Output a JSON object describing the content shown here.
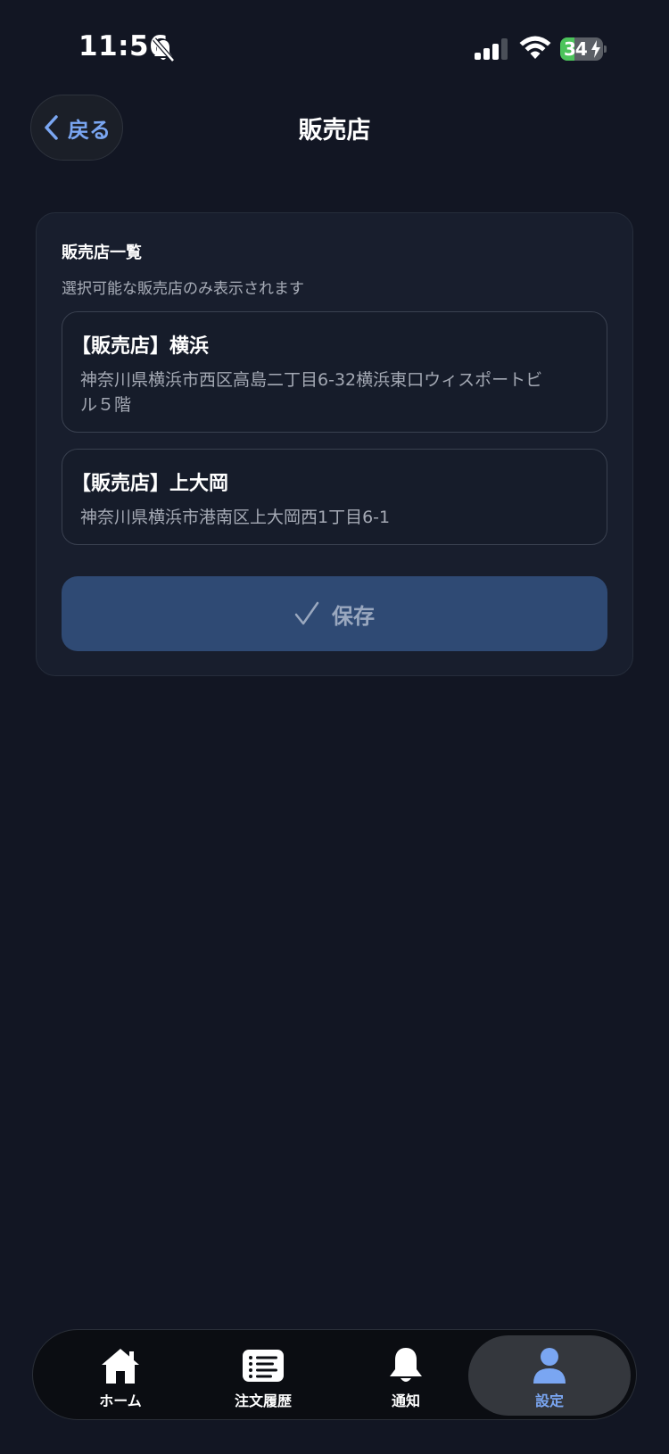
{
  "status_bar": {
    "time": "11:56",
    "battery_level": "34",
    "battery_fraction": 0.34
  },
  "header": {
    "back_label": "戻る",
    "title": "販売店"
  },
  "card": {
    "title": "販売店一覧",
    "subtitle": "選択可能な販売店のみ表示されます",
    "stores": [
      {
        "name": "【販売店】横浜",
        "address": "神奈川県横浜市西区高島二丁目6-32横浜東口ウィスポートビル５階"
      },
      {
        "name": "【販売店】上大岡",
        "address": "神奈川県横浜市港南区上大岡西1丁目6-1"
      }
    ],
    "save_label": "保存"
  },
  "tab_bar": {
    "items": [
      {
        "label": "ホーム",
        "icon": "home-icon"
      },
      {
        "label": "注文履歴",
        "icon": "list-icon"
      },
      {
        "label": "通知",
        "icon": "bell-icon"
      },
      {
        "label": "設定",
        "icon": "person-icon"
      }
    ],
    "active": "設定"
  },
  "colors": {
    "background": "#121623",
    "card": "#181e2d",
    "accent": "#7aa6f2",
    "save_button": "#2f4a74",
    "battery": "#4cc45b"
  }
}
